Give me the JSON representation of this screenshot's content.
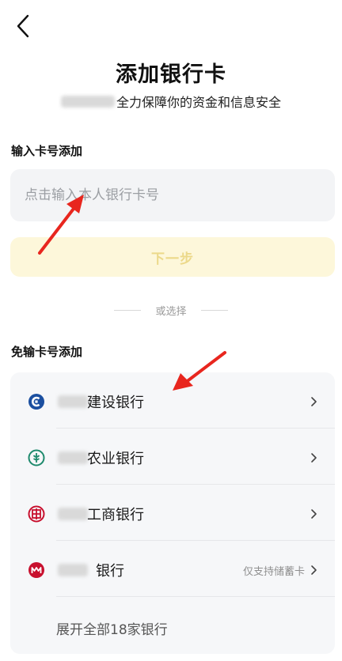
{
  "header": {
    "title": "添加银行卡",
    "subtitle": "全力保障你的资金和信息安全"
  },
  "card_number_section": {
    "title": "输入卡号添加",
    "input_placeholder": "点击输入本人银行卡号",
    "input_value": "",
    "next_label": "下一步"
  },
  "divider": {
    "label": "或选择"
  },
  "quick_section": {
    "title": "免输卡号添加",
    "banks": [
      {
        "name": "建设银行",
        "note": "",
        "logo_color": "#1b4fa0",
        "icon": "ccb-logo-icon"
      },
      {
        "name": "农业银行",
        "note": "",
        "logo_color": "#1e8a6d",
        "icon": "abc-logo-icon"
      },
      {
        "name": "工商银行",
        "note": "",
        "logo_color": "#c8102e",
        "icon": "icbc-logo-icon"
      },
      {
        "name": "银行",
        "note": "仅支持储蓄卡",
        "logo_color": "#c8102e",
        "icon": "cmb-logo-icon"
      }
    ],
    "expand_label": "展开全部18家银行"
  },
  "colors": {
    "accent_disabled_bg": "#fdf7da",
    "accent_disabled_text": "#ecd98a",
    "annotation_arrow": "#e8261e"
  }
}
